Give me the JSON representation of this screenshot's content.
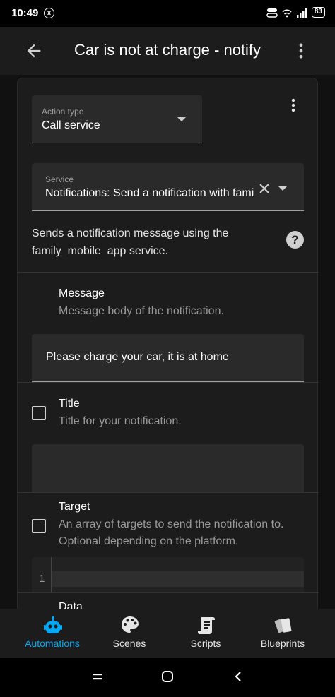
{
  "status_bar": {
    "time": "10:49",
    "notif_badge": "x",
    "battery": "83"
  },
  "app_bar": {
    "title": "Car is not at charge - notify"
  },
  "action": {
    "type_label": "Action type",
    "type_value": "Call service"
  },
  "service": {
    "label": "Service",
    "value": "Notifications: Send a notification with family_mobile_app",
    "description": "Sends a notification message using the family_mobile_app service.",
    "help_icon": "?"
  },
  "params": {
    "message": {
      "title": "Message",
      "description": "Message body of the notification.",
      "value": "Please charge your car, it is at home"
    },
    "title": {
      "title": "Title",
      "description": "Title for your notification.",
      "value": ""
    },
    "target": {
      "title": "Target",
      "description": "An array of targets to send the notification to. Optional depending on the platform.",
      "line_number": "1"
    },
    "data": {
      "title": "Data"
    }
  },
  "bottom_nav": {
    "items": [
      {
        "label": "Automations",
        "icon": "robot-icon",
        "active": true
      },
      {
        "label": "Scenes",
        "icon": "palette-icon",
        "active": false
      },
      {
        "label": "Scripts",
        "icon": "script-icon",
        "active": false
      },
      {
        "label": "Blueprints",
        "icon": "blueprint-icon",
        "active": false
      }
    ]
  },
  "colors": {
    "accent": "#03a9f4",
    "surface": "#1c1c1c",
    "field": "#2a2a2a",
    "background": "#111111"
  }
}
